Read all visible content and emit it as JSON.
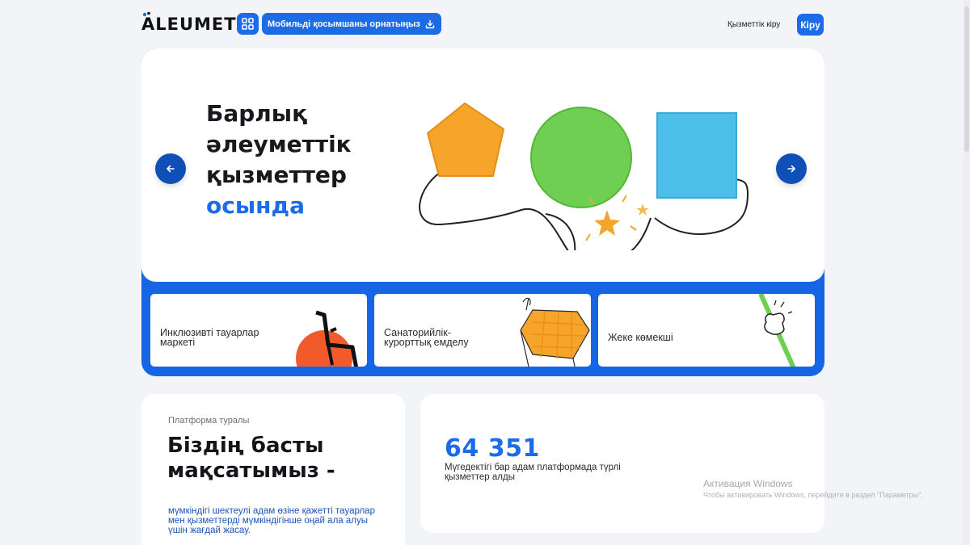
{
  "header": {
    "logo": "ALEUMET",
    "install_label": "Мобильді қосымшаны орнатыңыз",
    "service_login": "Қызметтік кіру",
    "login": "Кіру"
  },
  "hero": {
    "title_lines": [
      "Барлық",
      "әлеуметтік",
      "қызметтер"
    ],
    "title_accent": "осында"
  },
  "cards": [
    {
      "label_lines": [
        "Инклюзивті тауарлар",
        "маркеті"
      ]
    },
    {
      "label_lines": [
        "Санаторийлік-",
        "курорттық емделу"
      ]
    },
    {
      "label_lines": [
        "Жеке көмекші"
      ]
    }
  ],
  "about": {
    "small": "Платформа туралы",
    "title_lines": [
      "Біздің басты",
      "мақсатымыз -"
    ],
    "desc": "мүмкіндігі шектеулі адам өзіне қажетті тауарлар мен қызметтерді мүмкіндігінше оңай ала алуы үшін жағдай жасау."
  },
  "stats": {
    "number": "64 351",
    "desc": "Мүгедектігі бар адам платформада түрлі қызметтер алды"
  },
  "windows": {
    "activate": "Активация Windows",
    "sub": "Чтобы активировать Windows, перейдите в раздел \"Параметры\"."
  },
  "colors": {
    "accent": "#1c6ce8",
    "hero_band": "#1665e4",
    "arrow_buttons": "#0f4fb8",
    "shape_orange": "#f6a52a",
    "shape_green": "#6fcf52",
    "shape_blue": "#4cc0ea"
  },
  "icons": [
    "apps-grid-icon",
    "download-icon",
    "arrow-left-icon",
    "arrow-right-icon",
    "wheelchair-icon",
    "bed-icon",
    "helping-hand-icon"
  ]
}
